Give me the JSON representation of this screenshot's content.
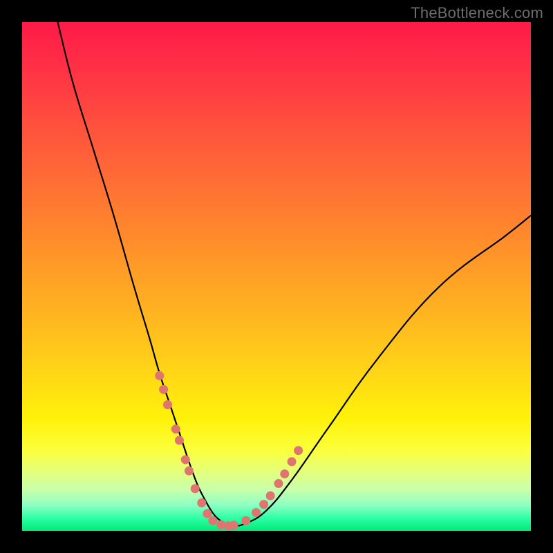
{
  "watermark": "TheBottleneck.com",
  "colors": {
    "frame": "#000000",
    "gradient_top": "#ff1a49",
    "gradient_bottom": "#00e878",
    "curve": "#000000",
    "dots": "#e0746e"
  },
  "chart_data": {
    "type": "line",
    "title": "",
    "xlabel": "",
    "ylabel": "",
    "xlim": [
      0,
      100
    ],
    "ylim": [
      0,
      100
    ],
    "series": [
      {
        "name": "bottleneck-curve",
        "x": [
          7,
          10,
          14,
          18,
          22,
          25,
          27,
          29,
          31,
          33,
          34.5,
          36,
          37.5,
          39,
          41,
          44,
          48,
          53,
          60,
          70,
          82,
          95,
          100
        ],
        "y": [
          100,
          88,
          75,
          62,
          48,
          38,
          31,
          25,
          19,
          13,
          9,
          6,
          3.5,
          2,
          1,
          1.5,
          4,
          10,
          20,
          34,
          48,
          58,
          62
        ]
      }
    ],
    "markers": [
      {
        "x": 27.0,
        "y": 30.5
      },
      {
        "x": 27.8,
        "y": 27.8
      },
      {
        "x": 28.6,
        "y": 24.8
      },
      {
        "x": 30.2,
        "y": 20.0
      },
      {
        "x": 30.9,
        "y": 17.8
      },
      {
        "x": 32.1,
        "y": 14.0
      },
      {
        "x": 32.8,
        "y": 11.8
      },
      {
        "x": 34.0,
        "y": 8.3
      },
      {
        "x": 35.3,
        "y": 5.5
      },
      {
        "x": 36.4,
        "y": 3.4
      },
      {
        "x": 37.5,
        "y": 2.0
      },
      {
        "x": 39.1,
        "y": 1.2
      },
      {
        "x": 40.5,
        "y": 1.0
      },
      {
        "x": 41.6,
        "y": 1.1
      },
      {
        "x": 44.0,
        "y": 2.0
      },
      {
        "x": 46.0,
        "y": 3.6
      },
      {
        "x": 47.5,
        "y": 5.2
      },
      {
        "x": 48.8,
        "y": 6.9
      },
      {
        "x": 50.4,
        "y": 9.3
      },
      {
        "x": 51.6,
        "y": 11.2
      },
      {
        "x": 53.0,
        "y": 13.6
      },
      {
        "x": 54.3,
        "y": 15.8
      }
    ]
  }
}
